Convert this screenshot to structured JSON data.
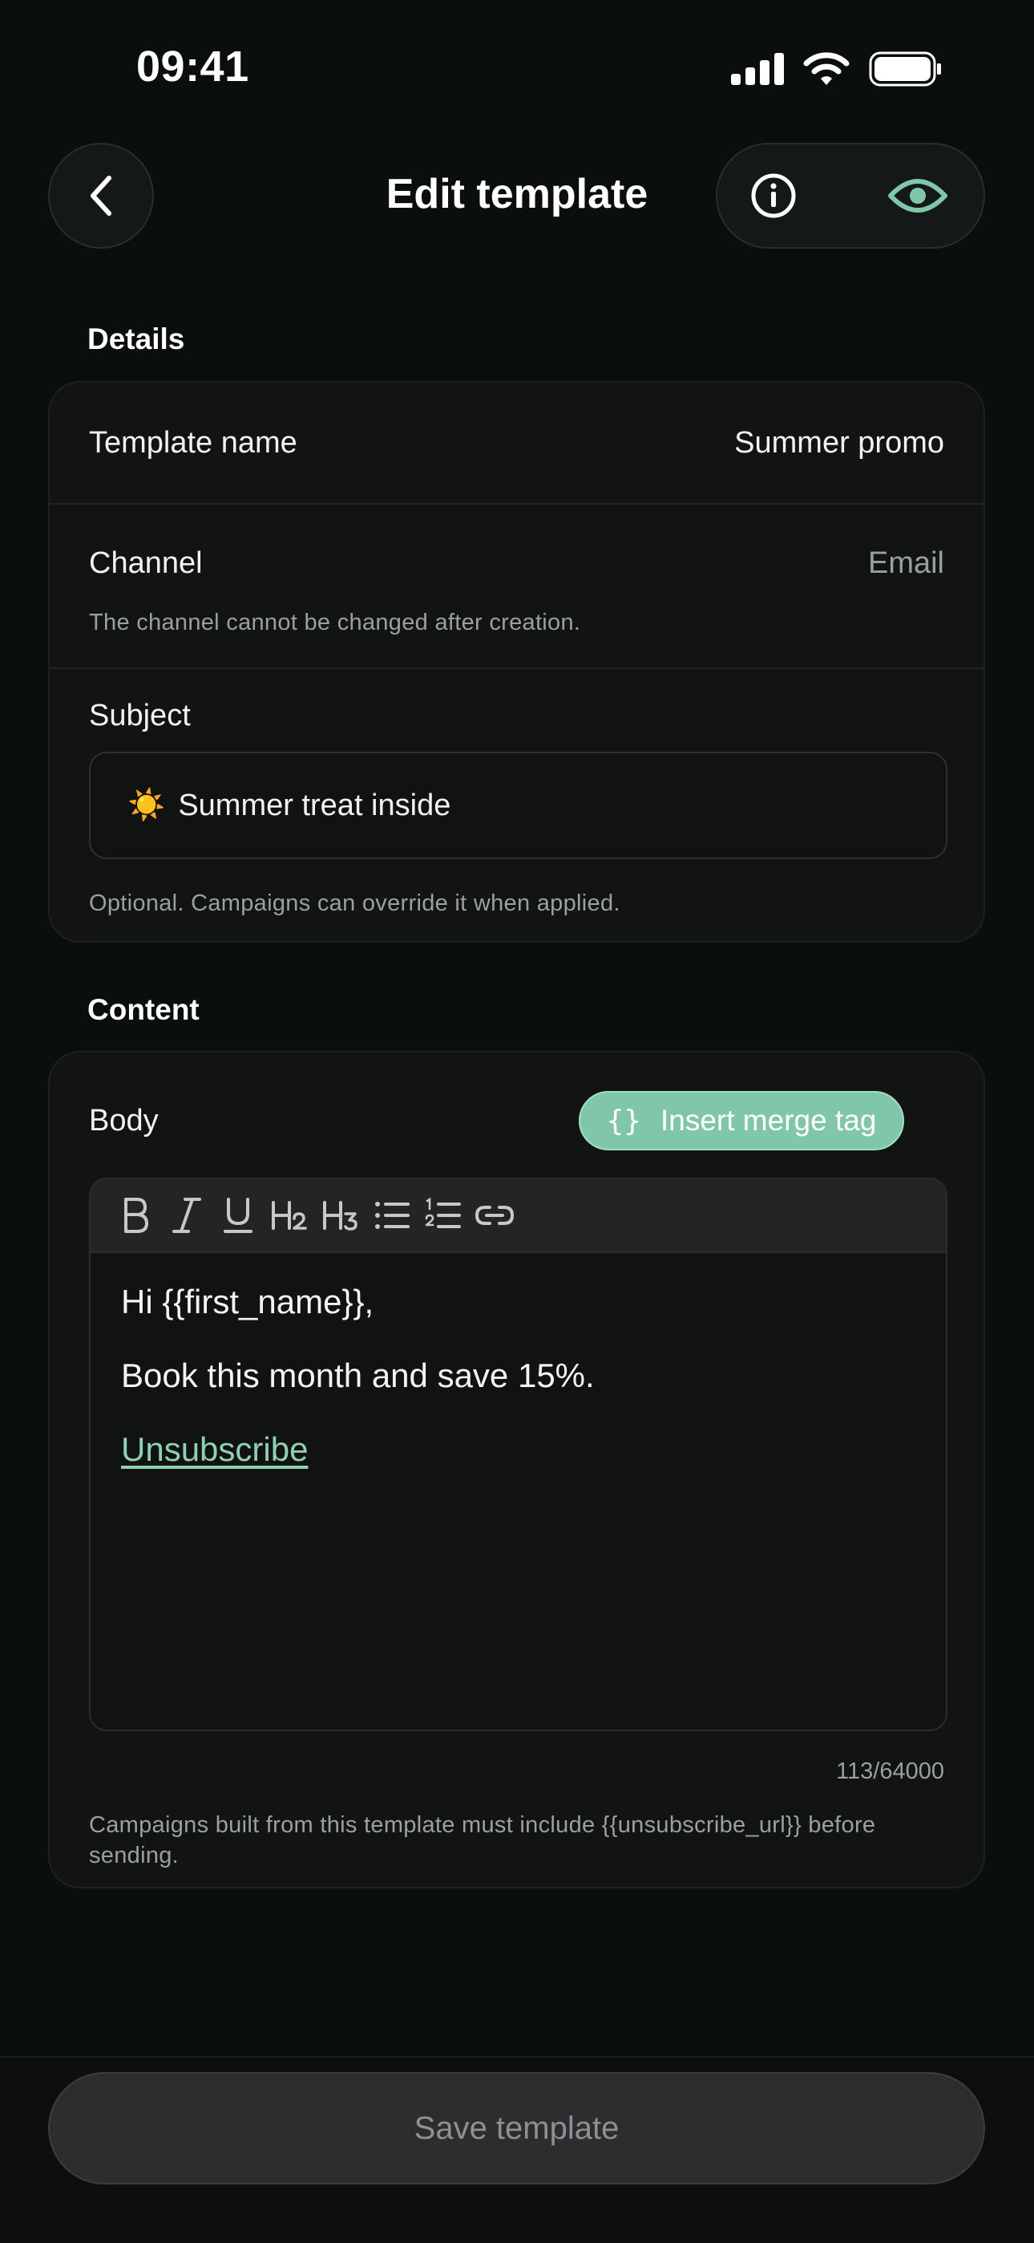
{
  "status_bar": {
    "time": "09:41"
  },
  "header": {
    "title": "Edit template"
  },
  "details": {
    "section_label": "Details",
    "template_name_label": "Template name",
    "template_name_value": "Summer promo",
    "channel_label": "Channel",
    "channel_value": "Email",
    "channel_hint": "The channel cannot be changed after creation.",
    "subject_label": "Subject",
    "subject_emoji": "☀️",
    "subject_value": "Summer treat inside",
    "subject_hint": "Optional. Campaigns can override it when applied."
  },
  "content": {
    "section_label": "Content",
    "body_label": "Body",
    "merge_tag_icon": "{}",
    "merge_tag_button": "Insert merge tag",
    "toolbar": [
      "bold-icon",
      "italic-icon",
      "underline-icon",
      "heading2-icon",
      "heading3-icon",
      "bullet-list-icon",
      "numbered-list-icon",
      "link-icon"
    ],
    "body_line1": "Hi {{first_name}},",
    "body_line2": "Book this month and save 15%.",
    "body_link": "Unsubscribe",
    "counter": "113/64000",
    "footer_hint": "Campaigns built from this template must include {{unsubscribe_url}} before sending."
  },
  "footer": {
    "save_label": "Save template"
  },
  "colors": {
    "accent": "#7fc7a8",
    "link": "#8fd0b2",
    "background": "#0b0e0e"
  }
}
